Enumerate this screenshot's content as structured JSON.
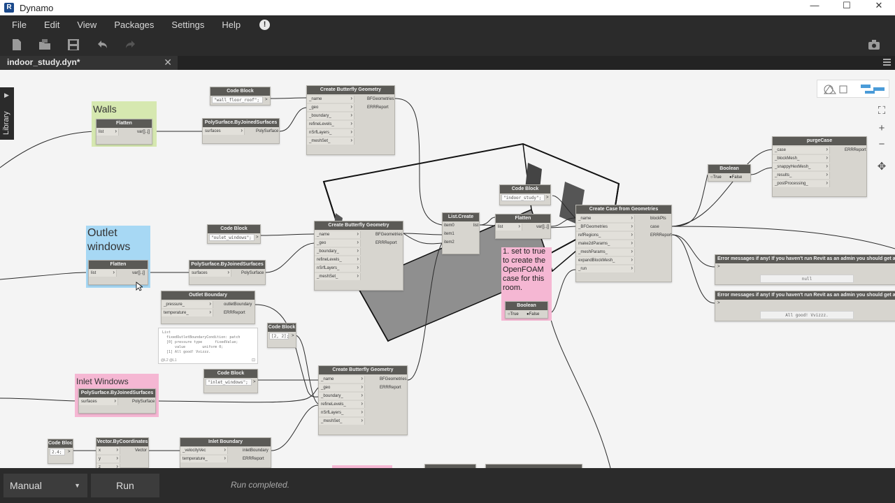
{
  "window": {
    "app_letter": "R",
    "title": "Dynamo",
    "minimize": "—",
    "maximize": "☐",
    "close": "✕"
  },
  "menu": {
    "items": [
      "File",
      "Edit",
      "View",
      "Packages",
      "Settings",
      "Help"
    ],
    "alert": "!"
  },
  "tab": {
    "name": "indoor_study.dyn*",
    "close": "✕"
  },
  "library": {
    "label": "Library",
    "arrow": "▶"
  },
  "groups": {
    "walls": "Walls",
    "outlet": "Outlet windows",
    "inlet": "Inlet Windows",
    "note": "1. set to true to create the OpenFOAM case for this room."
  },
  "nodes": {
    "code_block": "Code Block",
    "flatten": "Flatten",
    "polysurface": "PolySurface.ByJoinedSurfaces",
    "butterfly_geo": "Create Butterfly Geometry",
    "list_create": "List.Create",
    "boolean": "Boolean",
    "create_case": "Create Case from Geometries",
    "purge_case": "purgeCase",
    "outlet_boundary": "Outlet Boundary",
    "inlet_boundary": "Inlet Boundary",
    "vector": "Vector.ByCoordinates",
    "error_msg": "Error messages if any! If you haven't run Revit as an admin you should get an error about it"
  },
  "code": {
    "wall": "\"wall_floor_roof\";",
    "outlet": "\"oulet_windows\";",
    "inlet": "\"inlet_windows\";",
    "indoor": "\"indoor_study\";",
    "nums": "[2, 2];",
    "val": "2.4;"
  },
  "ports": {
    "list": "list",
    "var": "var[]..[]",
    "surfaces": "surfaces",
    "polysurface": "PolySurface",
    "name": "_name",
    "geo": "_geo",
    "boundary": "_boundary_",
    "refine": "refineLevels_",
    "nsrf": "nSrfLayers_",
    "meshset": "_meshSet_",
    "bfgeo": "BFGeometries",
    "err": "ERRReport",
    "item0": "item0",
    "item1": "item1",
    "item2": "item2",
    "bfgeometries_in": "_BFGeometries",
    "refregions": "refRegions_",
    "make2d": "make2dParams_",
    "meshparams": "_meshParams_",
    "expandblock": "expandBlockMesh_",
    "run": "_run",
    "blockpts": "blockPts",
    "case": "case",
    "case_in": "_case",
    "blockmesh": "_blockMesh_",
    "snappy": "_snappyHexMesh_",
    "results": "_results_",
    "post": "_postProcessing_",
    "pressure": "_pressure_",
    "temperature": "temperature_",
    "outletboundary": "outletBoundary",
    "velocity": "_velocityVec",
    "inletboundary": "inletBoundary",
    "x": "x",
    "y": "y",
    "z": "z",
    "vector": "Vector",
    "gt": ">"
  },
  "bool": {
    "true": "True",
    "false": "False"
  },
  "watch_text": "List\n  fixedOutletBoundaryCondition: patch\n  [0] pressure type      fixedValue;\n      value        uniform 0;\n  [1] All good! Vvizzz.",
  "watch_footer": "@L2 @L1",
  "results": {
    "null": "null",
    "good": "All good! Vvizzz."
  },
  "run_mode": "Manual",
  "run_label": "Run",
  "status": "Run completed."
}
